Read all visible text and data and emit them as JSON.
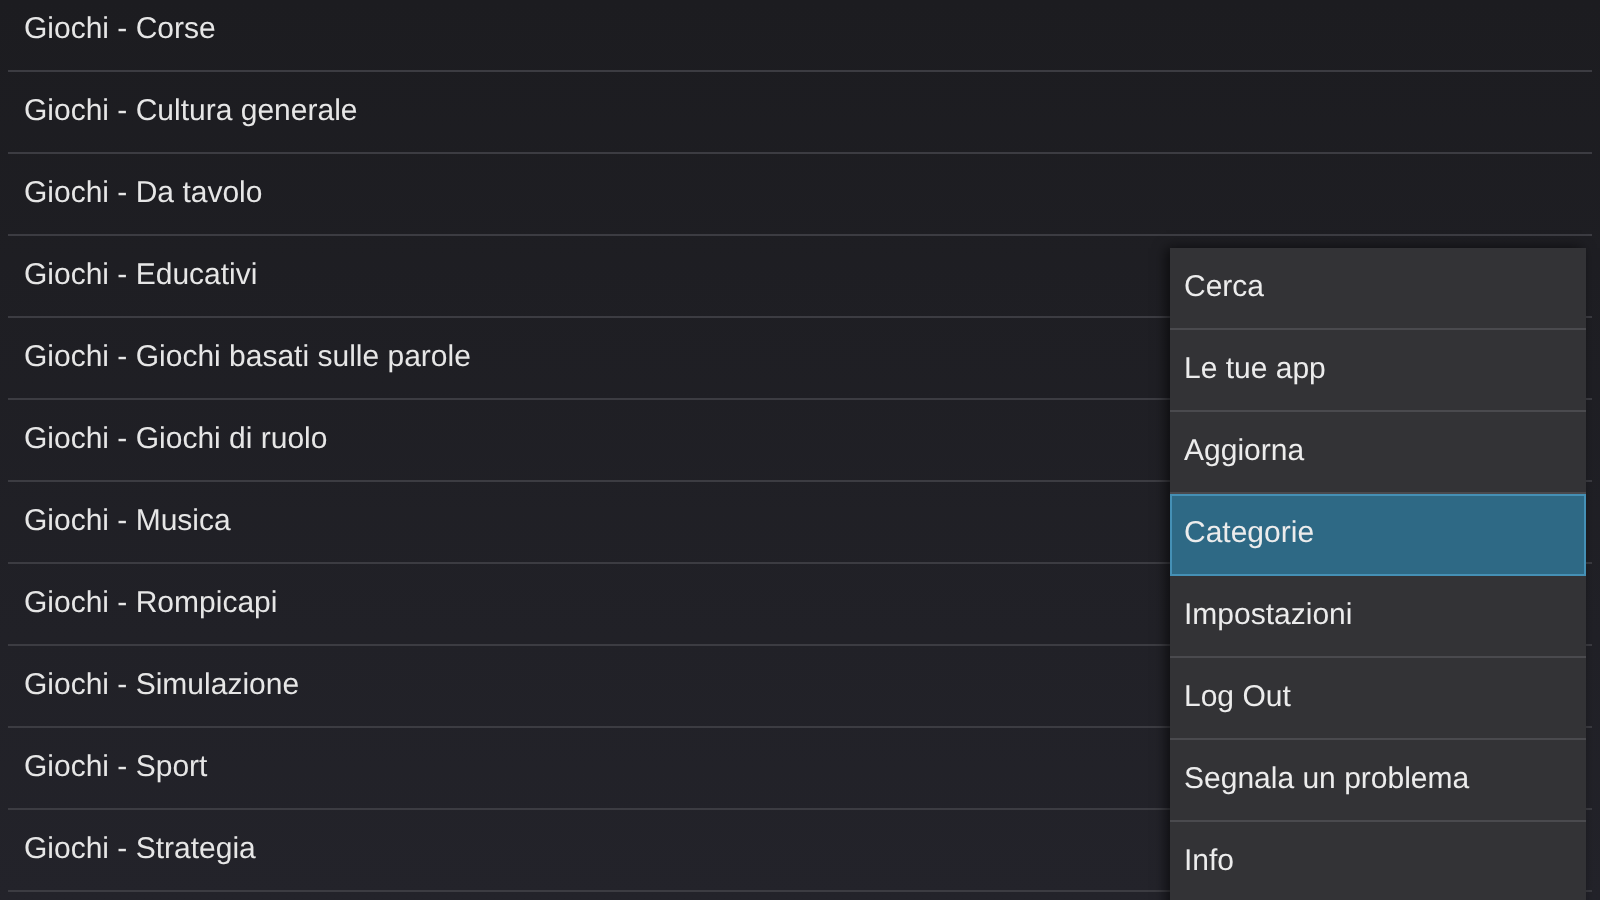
{
  "categories": [
    {
      "label": "Giochi - Corse"
    },
    {
      "label": "Giochi - Cultura generale"
    },
    {
      "label": "Giochi - Da tavolo"
    },
    {
      "label": "Giochi - Educativi"
    },
    {
      "label": "Giochi - Giochi basati sulle parole"
    },
    {
      "label": "Giochi - Giochi di ruolo"
    },
    {
      "label": "Giochi - Musica"
    },
    {
      "label": "Giochi - Rompicapi"
    },
    {
      "label": "Giochi - Simulazione"
    },
    {
      "label": "Giochi - Sport"
    },
    {
      "label": "Giochi - Strategia"
    }
  ],
  "menu": [
    {
      "label": "Cerca",
      "selected": false
    },
    {
      "label": "Le tue app",
      "selected": false
    },
    {
      "label": "Aggiorna",
      "selected": false
    },
    {
      "label": "Categorie",
      "selected": true
    },
    {
      "label": "Impostazioni",
      "selected": false
    },
    {
      "label": "Log Out",
      "selected": false
    },
    {
      "label": "Segnala un problema",
      "selected": false
    },
    {
      "label": "Info",
      "selected": false
    }
  ]
}
